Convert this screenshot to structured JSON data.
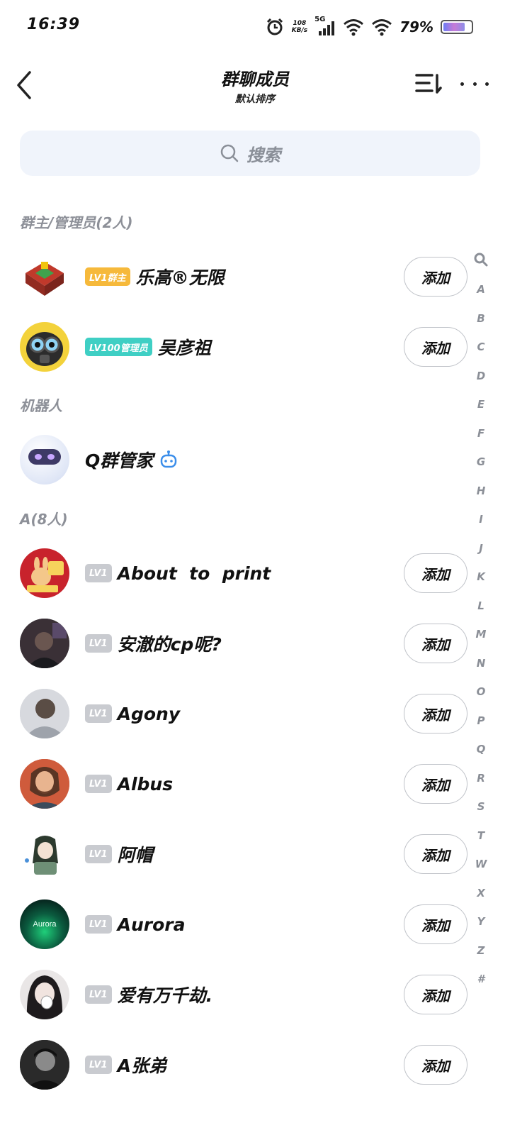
{
  "status": {
    "time": "16:39",
    "net_speed_value": "108",
    "net_speed_unit": "KB/s",
    "network": "5G",
    "battery": "79%",
    "battery_level": 0.79
  },
  "header": {
    "title": "群聊成员",
    "subtitle": "默认排序"
  },
  "search": {
    "placeholder": "搜索"
  },
  "sections": {
    "admins": "群主/管理员(2人)",
    "bots": "机器人",
    "a_group": "A(8人)"
  },
  "add_label": "添加",
  "members": [
    {
      "badge": "LV1群主",
      "badge_color": "#f6b93b",
      "name": "乐高®无限"
    },
    {
      "badge": "LV100管理员",
      "badge_color": "#3fcfc4",
      "name": "吴彦祖"
    },
    {
      "badge": "",
      "name": "Q群管家",
      "is_bot": true
    },
    {
      "badge": "LV1",
      "badge_color": "#c9cbd0",
      "name": "About  to  print"
    },
    {
      "badge": "LV1",
      "badge_color": "#c9cbd0",
      "name": "安澈的cp呢?"
    },
    {
      "badge": "LV1",
      "badge_color": "#c9cbd0",
      "name": "Agony"
    },
    {
      "badge": "LV1",
      "badge_color": "#c9cbd0",
      "name": "Albus"
    },
    {
      "badge": "LV1",
      "badge_color": "#c9cbd0",
      "name": "阿帽"
    },
    {
      "badge": "LV1",
      "badge_color": "#c9cbd0",
      "name": "Aurora",
      "avatar_text": "Aurora"
    },
    {
      "badge": "LV1",
      "badge_color": "#c9cbd0",
      "name": "爱有万千劫."
    },
    {
      "badge": "LV1",
      "badge_color": "#c9cbd0",
      "name": "A张弟"
    }
  ],
  "index_letters": [
    "A",
    "B",
    "C",
    "D",
    "E",
    "F",
    "G",
    "H",
    "I",
    "J",
    "K",
    "L",
    "M",
    "N",
    "O",
    "P",
    "Q",
    "R",
    "S",
    "T",
    "W",
    "X",
    "Y",
    "Z",
    "#"
  ],
  "icons": {
    "back": "chevron-left-icon",
    "sort": "sort-icon",
    "more": "more-dots-icon",
    "search": "search-icon",
    "robot": "robot-icon"
  }
}
